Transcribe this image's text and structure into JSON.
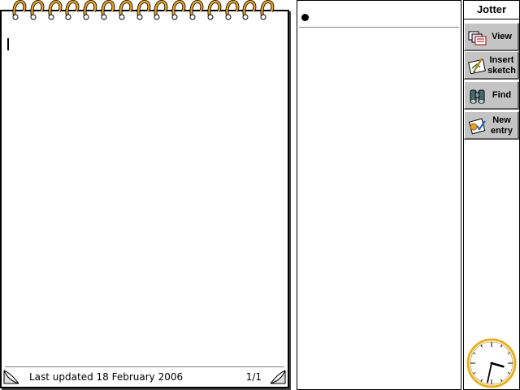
{
  "app": {
    "title": "Jotter"
  },
  "notebook": {
    "status": "Last updated 18 February 2006",
    "page_indicator": "1/1",
    "ring_count": 15
  },
  "toolbar": {
    "buttons": [
      {
        "label": "View",
        "icon": "view-icon"
      },
      {
        "label": "Insert\nsketch",
        "icon": "sketch-icon"
      },
      {
        "label": "Find",
        "icon": "binoculars-icon"
      },
      {
        "label": "New\nentry",
        "icon": "new-entry-icon"
      }
    ]
  },
  "clock": {
    "hour": 3,
    "minute": 32,
    "face_color": "#ffffff",
    "rim_color": "#e8b020"
  },
  "colors": {
    "button_face": "#c4c4c4",
    "ring": "#e8a020"
  }
}
